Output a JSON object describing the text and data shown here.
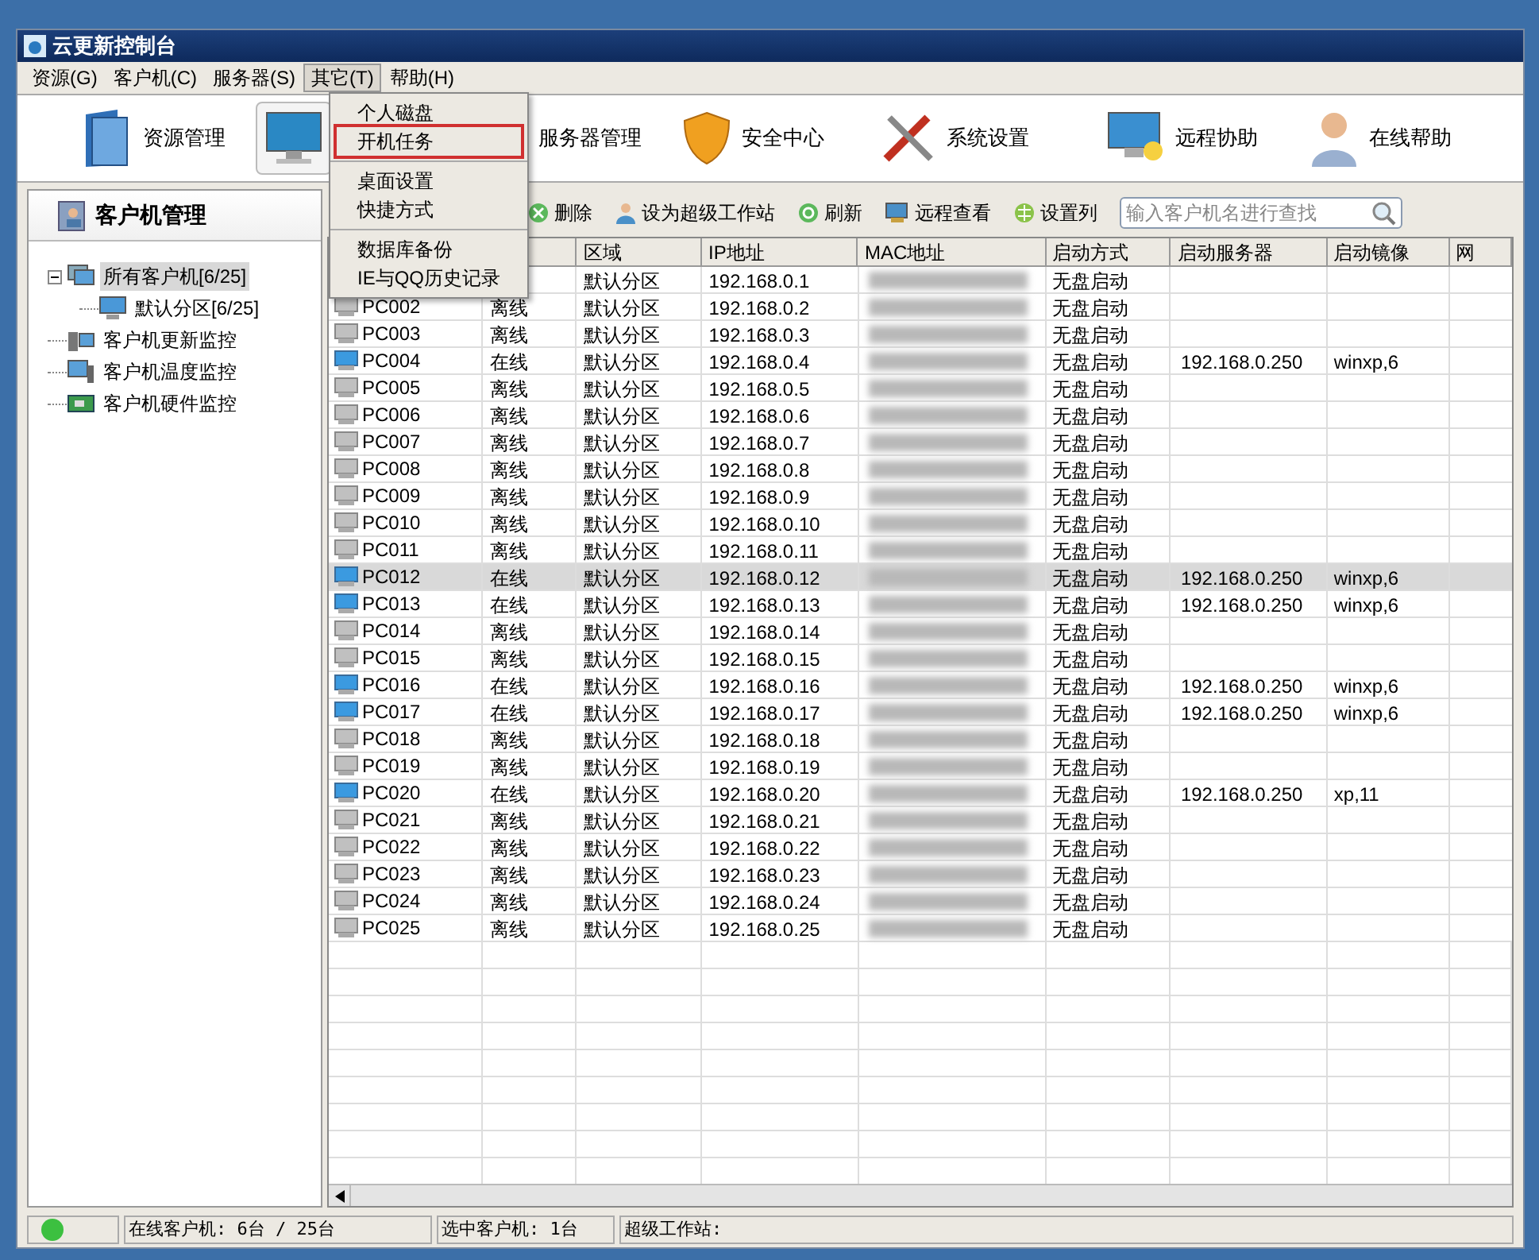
{
  "window": {
    "title": "云更新控制台"
  },
  "menu_bar": [
    {
      "label": "资源(G)",
      "open": false
    },
    {
      "label": "客户机(C)",
      "open": false
    },
    {
      "label": "服务器(S)",
      "open": false
    },
    {
      "label": "其它(T)",
      "open": true
    },
    {
      "label": "帮助(H)",
      "open": false
    }
  ],
  "dropdown": {
    "groups": [
      [
        {
          "label": "个人磁盘",
          "highlighted": false
        },
        {
          "label": "开机任务",
          "highlighted": true
        }
      ],
      [
        {
          "label": "桌面设置",
          "highlighted": false
        },
        {
          "label": "快捷方式",
          "highlighted": false
        }
      ],
      [
        {
          "label": "数据库备份",
          "highlighted": false
        },
        {
          "label": "IE与QQ历史记录",
          "highlighted": false
        }
      ]
    ]
  },
  "main_toolbar": [
    {
      "kind": "folder",
      "label": "资源管理",
      "selected": false
    },
    {
      "kind": "monitor",
      "selected": true
    },
    {
      "kind": "text",
      "label": "服务器管理",
      "selected": false
    },
    {
      "kind": "shield",
      "label": "安全中心",
      "selected": false
    },
    {
      "kind": "tools",
      "label": "系统设置",
      "selected": false
    },
    {
      "kind": "remote",
      "label": "远程协助",
      "selected": false
    },
    {
      "kind": "person",
      "label": "在线帮助",
      "selected": false
    }
  ],
  "sidebar": {
    "title": "客户机管理",
    "tree": [
      {
        "label": "所有客户机[6/25]",
        "kind": "group",
        "expanded": true,
        "selected": true,
        "children": [
          {
            "label": "默认分区[6/25]",
            "kind": "monitor",
            "selected": false
          }
        ]
      },
      {
        "label": "客户机更新监控",
        "kind": "update",
        "selected": false
      },
      {
        "label": "客户机温度监控",
        "kind": "temperature",
        "selected": false
      },
      {
        "label": "客户机硬件监控",
        "kind": "hardware",
        "selected": false
      }
    ]
  },
  "action_toolbar": {
    "buttons": [
      {
        "kind": "delete",
        "label": "删除"
      },
      {
        "kind": "user",
        "label": "设为超级工作站"
      },
      {
        "kind": "refresh",
        "label": "刷新"
      },
      {
        "kind": "remote",
        "label": "远程查看"
      },
      {
        "kind": "columns",
        "label": "设置列"
      }
    ],
    "search": {
      "placeholder": "输入客户机名进行查找"
    }
  },
  "table": {
    "columns": [
      "区域",
      "IP地址",
      "MAC地址",
      "启动方式",
      "启动服务器",
      "启动镜像",
      "网"
    ],
    "rows": [
      {
        "zone": "默认分区",
        "ip": "192.168.0.1",
        "boot": "无盘启动",
        "selected": false
      },
      {
        "name": "PC002",
        "status": "离线",
        "zone": "默认分区",
        "ip": "192.168.0.2",
        "boot": "无盘启动",
        "online": false,
        "selected": false
      },
      {
        "name": "PC003",
        "status": "离线",
        "zone": "默认分区",
        "ip": "192.168.0.3",
        "boot": "无盘启动",
        "online": false,
        "selected": false
      },
      {
        "name": "PC004",
        "status": "在线",
        "zone": "默认分区",
        "ip": "192.168.0.4",
        "boot": "无盘启动",
        "server": "192.168.0.250",
        "image": "winxp,6",
        "online": true,
        "selected": false
      },
      {
        "name": "PC005",
        "status": "离线",
        "zone": "默认分区",
        "ip": "192.168.0.5",
        "boot": "无盘启动",
        "online": false,
        "selected": false
      },
      {
        "name": "PC006",
        "status": "离线",
        "zone": "默认分区",
        "ip": "192.168.0.6",
        "boot": "无盘启动",
        "online": false,
        "selected": false
      },
      {
        "name": "PC007",
        "status": "离线",
        "zone": "默认分区",
        "ip": "192.168.0.7",
        "boot": "无盘启动",
        "online": false,
        "selected": false
      },
      {
        "name": "PC008",
        "status": "离线",
        "zone": "默认分区",
        "ip": "192.168.0.8",
        "boot": "无盘启动",
        "online": false,
        "selected": false
      },
      {
        "name": "PC009",
        "status": "离线",
        "zone": "默认分区",
        "ip": "192.168.0.9",
        "boot": "无盘启动",
        "online": false,
        "selected": false
      },
      {
        "name": "PC010",
        "status": "离线",
        "zone": "默认分区",
        "ip": "192.168.0.10",
        "boot": "无盘启动",
        "online": false,
        "selected": false
      },
      {
        "name": "PC011",
        "status": "离线",
        "zone": "默认分区",
        "ip": "192.168.0.11",
        "boot": "无盘启动",
        "online": false,
        "selected": false
      },
      {
        "name": "PC012",
        "status": "在线",
        "zone": "默认分区",
        "ip": "192.168.0.12",
        "boot": "无盘启动",
        "server": "192.168.0.250",
        "image": "winxp,6",
        "online": true,
        "selected": true
      },
      {
        "name": "PC013",
        "status": "在线",
        "zone": "默认分区",
        "ip": "192.168.0.13",
        "boot": "无盘启动",
        "server": "192.168.0.250",
        "image": "winxp,6",
        "online": true,
        "selected": false
      },
      {
        "name": "PC014",
        "status": "离线",
        "zone": "默认分区",
        "ip": "192.168.0.14",
        "boot": "无盘启动",
        "online": false,
        "selected": false
      },
      {
        "name": "PC015",
        "status": "离线",
        "zone": "默认分区",
        "ip": "192.168.0.15",
        "boot": "无盘启动",
        "online": false,
        "selected": false
      },
      {
        "name": "PC016",
        "status": "在线",
        "zone": "默认分区",
        "ip": "192.168.0.16",
        "boot": "无盘启动",
        "server": "192.168.0.250",
        "image": "winxp,6",
        "online": true,
        "selected": false
      },
      {
        "name": "PC017",
        "status": "在线",
        "zone": "默认分区",
        "ip": "192.168.0.17",
        "boot": "无盘启动",
        "server": "192.168.0.250",
        "image": "winxp,6",
        "online": true,
        "selected": false
      },
      {
        "name": "PC018",
        "status": "离线",
        "zone": "默认分区",
        "ip": "192.168.0.18",
        "boot": "无盘启动",
        "online": false,
        "selected": false
      },
      {
        "name": "PC019",
        "status": "离线",
        "zone": "默认分区",
        "ip": "192.168.0.19",
        "boot": "无盘启动",
        "online": false,
        "selected": false
      },
      {
        "name": "PC020",
        "status": "在线",
        "zone": "默认分区",
        "ip": "192.168.0.20",
        "boot": "无盘启动",
        "server": "192.168.0.250",
        "image": "xp,11",
        "online": true,
        "selected": false
      },
      {
        "name": "PC021",
        "status": "离线",
        "zone": "默认分区",
        "ip": "192.168.0.21",
        "boot": "无盘启动",
        "online": false,
        "selected": false
      },
      {
        "name": "PC022",
        "status": "离线",
        "zone": "默认分区",
        "ip": "192.168.0.22",
        "boot": "无盘启动",
        "online": false,
        "selected": false
      },
      {
        "name": "PC023",
        "status": "离线",
        "zone": "默认分区",
        "ip": "192.168.0.23",
        "boot": "无盘启动",
        "online": false,
        "selected": false
      },
      {
        "name": "PC024",
        "status": "离线",
        "zone": "默认分区",
        "ip": "192.168.0.24",
        "boot": "无盘启动",
        "online": false,
        "selected": false
      },
      {
        "name": "PC025",
        "status": "离线",
        "zone": "默认分区",
        "ip": "192.168.0.25",
        "boot": "无盘启动",
        "online": false,
        "selected": false
      }
    ]
  },
  "status_bar": {
    "connected": true,
    "online": "在线客户机: 6台 / 25台",
    "selected": "选中客户机: 1台",
    "super_station": "超级工作站:"
  }
}
